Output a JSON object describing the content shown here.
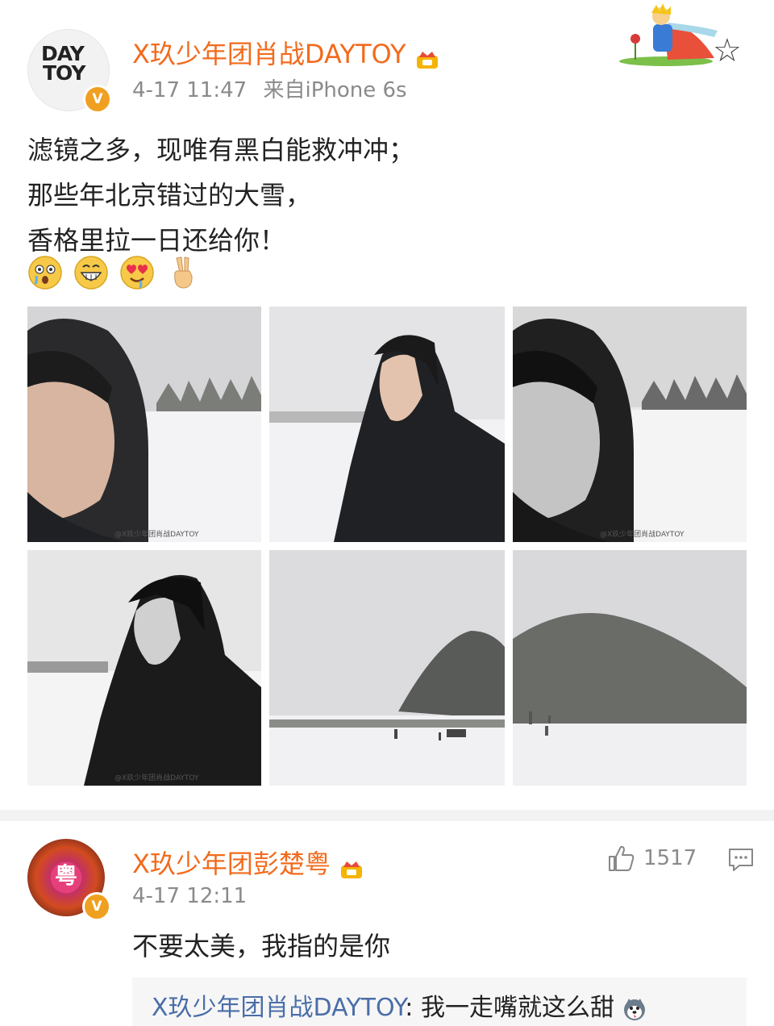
{
  "post": {
    "username": "X玖少年团肖战DAYTOY",
    "avatar_logo_line1": "DAY",
    "avatar_logo_line2": "TOY",
    "verified_mark": "V",
    "time": "4-17 11:47",
    "source": "来自iPhone 6s",
    "text_line1": "滤镜之多，现唯有黑白能救冲冲；",
    "text_line2": "那些年北京错过的大雪，",
    "text_line3": "香格里拉一日还给你！",
    "emojis": [
      "astonished-emoji",
      "grin-emoji",
      "heart-eyes-emoji",
      "victory-hand-emoji"
    ],
    "photos": [
      {
        "name": "photo-1",
        "watermark": "@X玖少年团肖战DAYTOY"
      },
      {
        "name": "photo-2",
        "watermark": ""
      },
      {
        "name": "photo-3",
        "watermark": "@X玖少年团肖战DAYTOY"
      },
      {
        "name": "photo-4",
        "watermark": "@X玖少年团肖战DAYTOY"
      },
      {
        "name": "photo-5",
        "watermark": ""
      },
      {
        "name": "photo-6",
        "watermark": ""
      }
    ],
    "favorite_icon": "star-icon",
    "decoration_icon": "little-prince-sticker"
  },
  "comment": {
    "username": "X玖少年团彭楚粤",
    "avatar_text": "粤",
    "verified_mark": "V",
    "time": "4-17 12:11",
    "text": "不要太美，我指的是你",
    "like_count": "1517",
    "like_icon": "thumbs-up-icon",
    "reply_icon": "comment-icon"
  },
  "reply": {
    "username": "X玖少年团肖战DAYTOY",
    "separator": ":",
    "text": " 我一走嘴就这么甜"
  },
  "colors": {
    "username": "#f26b1d",
    "reply_username": "#4a6ea8",
    "meta": "#8a8a8a",
    "divider": "#f2f2f2"
  }
}
